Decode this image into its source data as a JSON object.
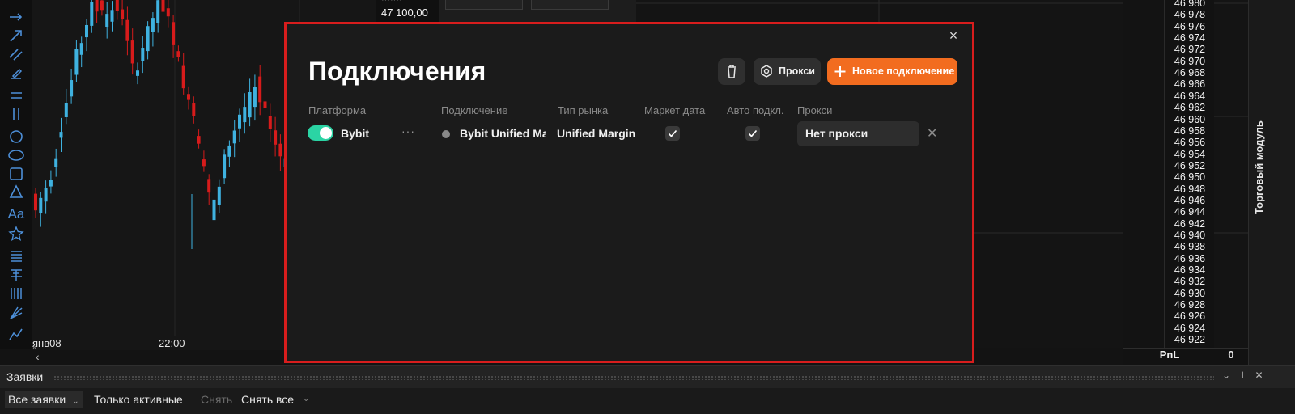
{
  "toolbar": {
    "tools": [
      "arrow-right-icon",
      "arrow-diagonal-icon",
      "parallel-lines-icon",
      "brush-icon",
      "horizontal-lines-icon",
      "vertical-lines-icon",
      "circle-icon",
      "ellipse-icon",
      "rectangle-icon",
      "triangle-icon",
      "text-tool-icon",
      "star-icon",
      "fibonacci-icon",
      "pitchfork-icon",
      "vertical-grid-icon",
      "fan-icon",
      "zigzag-icon"
    ],
    "text_tool_label": "Aa"
  },
  "chart": {
    "time_labels": [
      "янв08",
      "22:00"
    ],
    "colors": {
      "up": "#3fb2e0",
      "down": "#d71b1b"
    }
  },
  "order_book": {
    "price_top": "47 100,00"
  },
  "price_ladder": {
    "prices": [
      "46 980",
      "46 978",
      "46 976",
      "46 974",
      "46 972",
      "46 970",
      "46 968",
      "46 966",
      "46 964",
      "46 962",
      "46 960",
      "46 958",
      "46 956",
      "46 954",
      "46 952",
      "46 950",
      "46 948",
      "46 946",
      "46 944",
      "46 942",
      "46 940",
      "46 938",
      "46 936",
      "46 934",
      "46 932",
      "46 930",
      "46 928",
      "46 926",
      "46 924",
      "46 922"
    ],
    "pnl_label": "PnL",
    "pnl_value": "0"
  },
  "side_panel": {
    "label": "Торговый модуль"
  },
  "orders": {
    "title": "Заявки",
    "filter_all": "Все заявки",
    "only_active": "Только активные",
    "cancel": "Снять",
    "cancel_all": "Снять все"
  },
  "modal": {
    "title": "Подключения",
    "close": "×",
    "proxy_button": "Прокси",
    "new_connection_button": "Новое подключение",
    "accent_color": "#f26c1f",
    "columns": {
      "platform": "Платформа",
      "connection": "Подключение",
      "market_type": "Тип рынка",
      "market_data": "Маркет дата",
      "auto_connect": "Авто подкл.",
      "proxy": "Прокси"
    },
    "rows": [
      {
        "enabled": true,
        "platform": "Bybit",
        "menu": "···",
        "connection": "Bybit Unified Ma",
        "market_type": "Unified Margin",
        "market_data": true,
        "auto_connect": true,
        "proxy": "Нет прокси"
      }
    ]
  }
}
